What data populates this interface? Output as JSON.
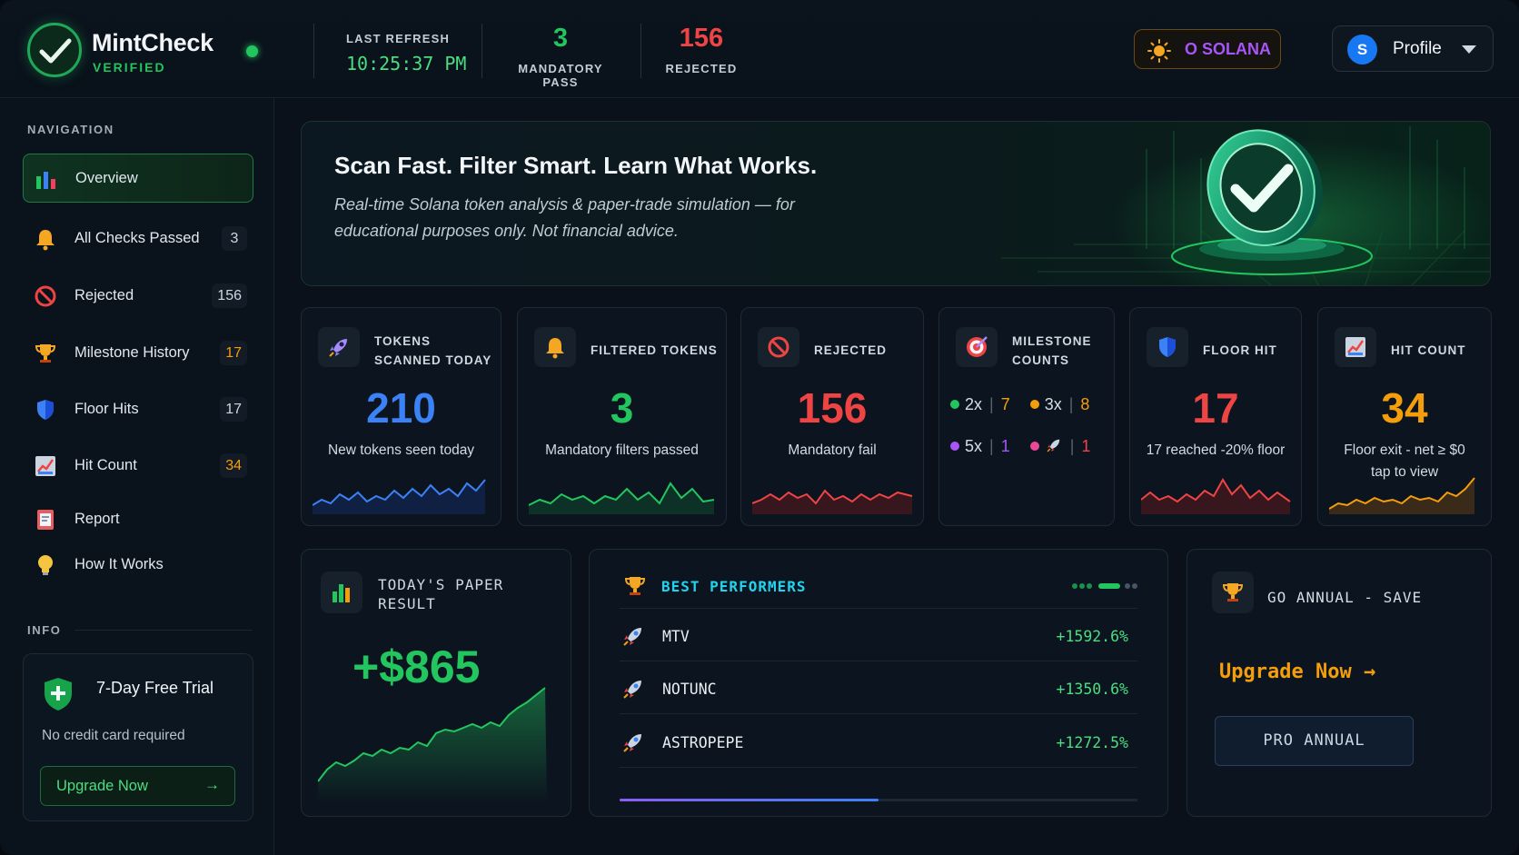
{
  "app": {
    "name": "MintCheck",
    "verified": "VERIFIED"
  },
  "header": {
    "last_refresh_label": "LAST REFRESH",
    "last_refresh_time": "10:25:37 PM",
    "mandatory_pass_value": "3",
    "mandatory_pass_label": "MANDATORY PASS",
    "rejected_value": "156",
    "rejected_label": "REJECTED",
    "network": "O SOLANA",
    "profile_initial": "S",
    "profile_label": "Profile"
  },
  "sidebar": {
    "nav_label": "NAVIGATION",
    "items": [
      {
        "label": "Overview",
        "count": null,
        "icon": "bar-chart-icon"
      },
      {
        "label": "All Checks Passed",
        "count": "3",
        "icon": "bell-icon"
      },
      {
        "label": "Rejected",
        "count": "156",
        "icon": "ban-icon"
      },
      {
        "label": "Milestone History",
        "count": "17",
        "icon": "trophy-icon"
      },
      {
        "label": "Floor Hits",
        "count": "17",
        "icon": "shield-icon"
      },
      {
        "label": "Hit Count",
        "count": "34",
        "icon": "chart-icon"
      },
      {
        "label": "Report",
        "count": null,
        "icon": "report-icon"
      },
      {
        "label": "How It Works",
        "count": null,
        "icon": "lightbulb-icon"
      }
    ],
    "info_label": "INFO",
    "trial": {
      "title": "7-Day Free Trial",
      "subtitle": "No credit card required",
      "button": "Upgrade Now",
      "arrow": "→"
    }
  },
  "hero": {
    "headline": "Scan Fast. Filter Smart. Learn What Works.",
    "tagline": "Real-time Solana token analysis & paper-trade simulation — for educational purposes only. Not financial advice."
  },
  "cards": [
    {
      "title": "TOKENS SCANNED TODAY",
      "value": "210",
      "sub": "New tokens seen today",
      "color": "#3b82f6"
    },
    {
      "title": "FILTERED TOKENS",
      "value": "3",
      "sub": "Mandatory filters passed",
      "color": "#22c55e"
    },
    {
      "title": "REJECTED",
      "value": "156",
      "sub": "Mandatory fail",
      "color": "#ef4444"
    },
    {
      "title": "MILESTONE COUNTS",
      "value": "",
      "sub": "",
      "color": "#a855f7"
    },
    {
      "title": "FLOOR HIT",
      "value": "17",
      "sub": "17 reached -20% floor",
      "color": "#ef4444"
    },
    {
      "title": "HIT COUNT",
      "value": "34",
      "sub": "Floor exit - net ≥ $0 tap to view",
      "color": "#f59e0b"
    }
  ],
  "milestones": [
    {
      "label": "2x",
      "count": "7",
      "dot": "#22c55e",
      "count_color": "#f59e0b"
    },
    {
      "label": "3x",
      "count": "8",
      "dot": "#f59e0b",
      "count_color": "#f59e0b"
    },
    {
      "label": "5x",
      "count": "1",
      "dot": "#a855f7",
      "count_color": "#a855f7"
    },
    {
      "label": "",
      "count": "1",
      "dot": "#ec4899",
      "count_color": "#ef4444"
    }
  ],
  "paper": {
    "title": "TODAY'S PAPER RESULT",
    "value": "+$865"
  },
  "best": {
    "title": "BEST PERFORMERS",
    "rows": [
      {
        "name": "MTV",
        "pct": "+1592.6%"
      },
      {
        "name": "NOTUNC",
        "pct": "+1350.6%"
      },
      {
        "name": "ASTROPEPE",
        "pct": "+1272.5%"
      }
    ],
    "progress": 0.5
  },
  "annual": {
    "title": "GO ANNUAL - SAVE",
    "upgrade": "Upgrade Now",
    "arrow": "→",
    "plan": "PRO ANNUAL"
  }
}
